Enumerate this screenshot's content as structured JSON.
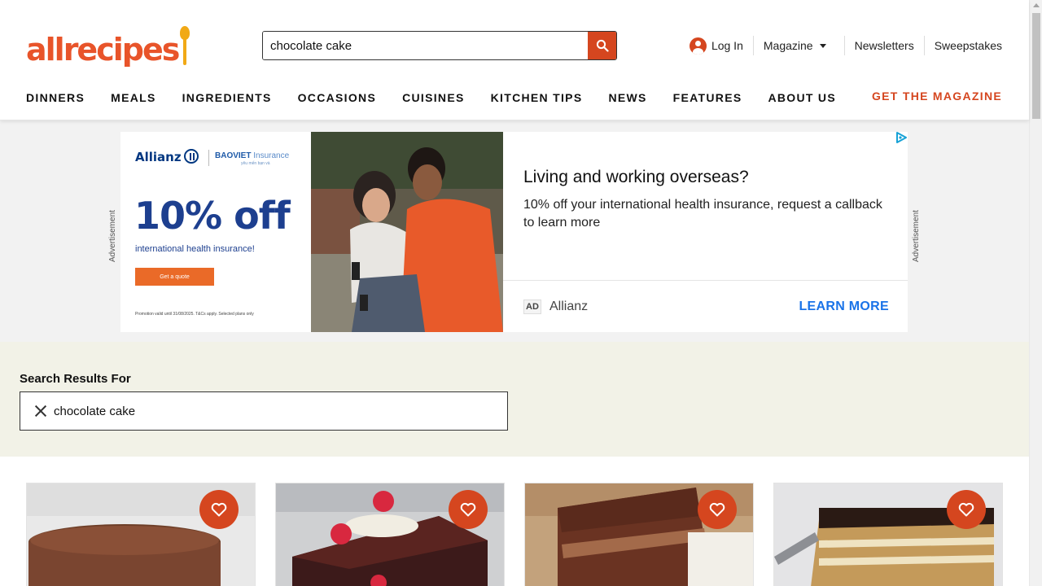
{
  "brand": {
    "logo_text": "allrecipes"
  },
  "search": {
    "value": "chocolate cake",
    "button_icon": "search-icon"
  },
  "utility": {
    "login": "Log In",
    "magazine": "Magazine",
    "newsletters": "Newsletters",
    "sweepstakes": "Sweepstakes"
  },
  "nav": {
    "items": [
      {
        "label": "DINNERS"
      },
      {
        "label": "MEALS"
      },
      {
        "label": "INGREDIENTS"
      },
      {
        "label": "OCCASIONS"
      },
      {
        "label": "CUISINES"
      },
      {
        "label": "KITCHEN TIPS"
      },
      {
        "label": "NEWS"
      },
      {
        "label": "FEATURES"
      },
      {
        "label": "ABOUT US"
      }
    ],
    "cta": "GET THE MAGAZINE"
  },
  "ad": {
    "side_label": "Advertisement",
    "brand": "Allianz",
    "partner": "BAOVIET",
    "partner_suffix": "Insurance",
    "partner_tagline": "yêu mến bạn và",
    "big_text": "10% off",
    "sub_text": "international health insurance!",
    "button": "Get a quote",
    "fine_print": "Promotion valid until 31/08/2025. T&Cs apply. Selected plans only",
    "headline": "Living and working overseas?",
    "description": "10% off your international health insurance, request a callback to learn more",
    "badge": "AD",
    "advertiser": "Allianz",
    "cta": "LEARN MORE"
  },
  "results": {
    "title": "Search Results For",
    "query": "chocolate cake"
  },
  "cards": [
    {
      "name": "card-1",
      "fav_icon": "heart-icon"
    },
    {
      "name": "card-2",
      "fav_icon": "heart-icon"
    },
    {
      "name": "card-3",
      "fav_icon": "heart-icon"
    },
    {
      "name": "card-4",
      "fav_icon": "heart-icon"
    }
  ],
  "colors": {
    "accent": "#d5461f",
    "logo": "#e8542a",
    "spoon": "#f1a916",
    "results_band": "#f2f2e7",
    "ad_link": "#1a73e8"
  }
}
